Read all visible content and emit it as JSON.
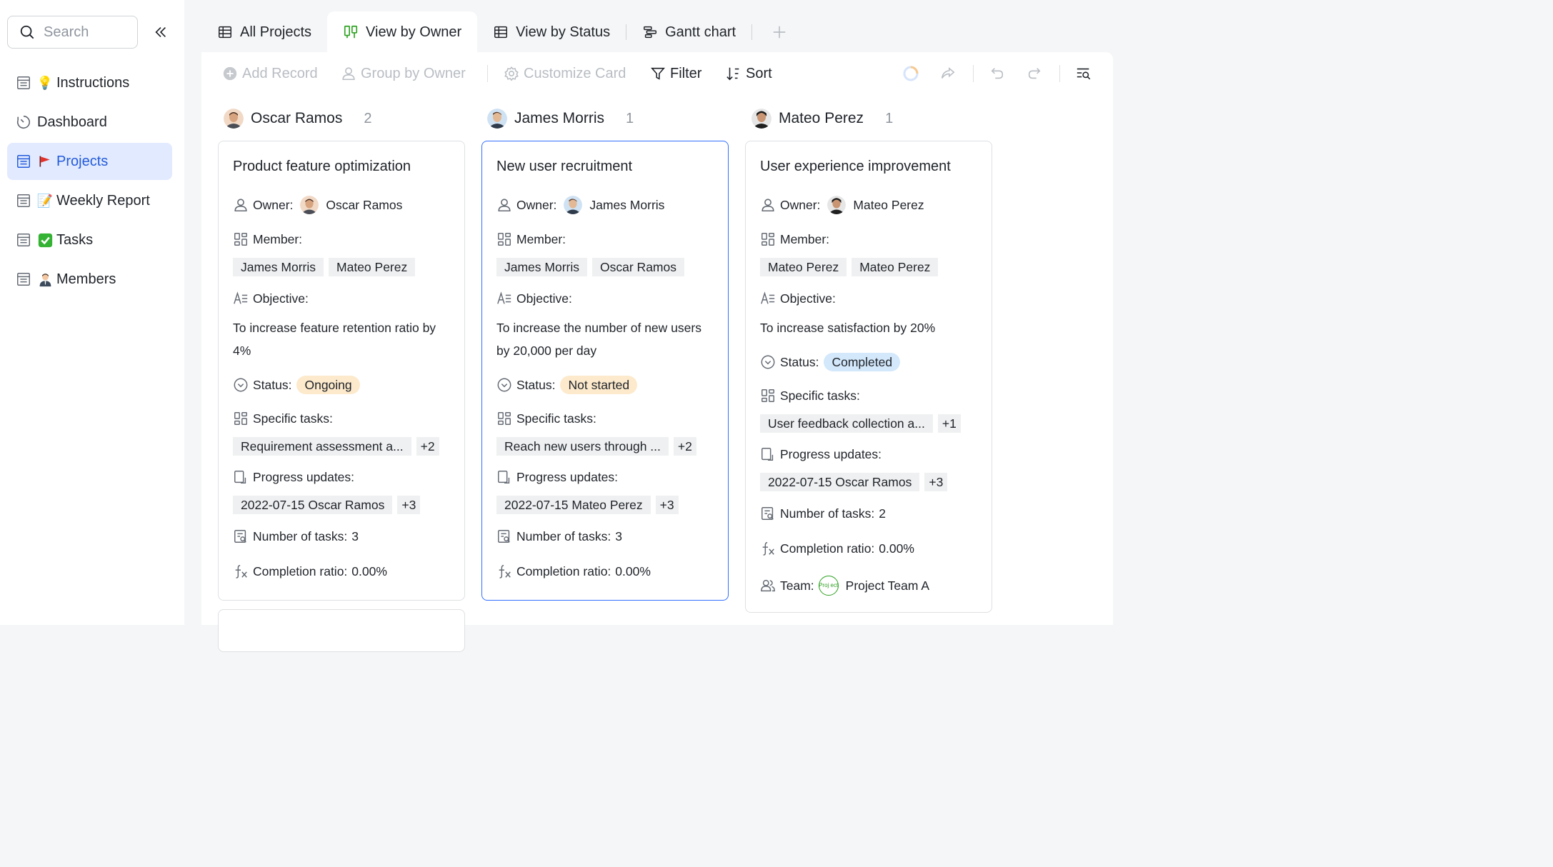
{
  "sidebar": {
    "search_placeholder": "Search",
    "items": [
      {
        "label": "Instructions",
        "emoji": "💡"
      },
      {
        "label": "Dashboard",
        "emoji": ""
      },
      {
        "label": "Projects",
        "emoji": "🚩",
        "active": true
      },
      {
        "label": "Weekly Report",
        "emoji": "📝"
      },
      {
        "label": "Tasks",
        "emoji": "✅"
      },
      {
        "label": "Members",
        "emoji": "👨‍💼"
      }
    ]
  },
  "tabs": [
    {
      "label": "All Projects",
      "icon": "table-icon"
    },
    {
      "label": "View by Owner",
      "icon": "kanban-icon",
      "active": true
    },
    {
      "label": "View by Status",
      "icon": "table-icon"
    },
    {
      "label": "Gantt chart",
      "icon": "gantt-icon"
    }
  ],
  "toolbar": {
    "add_record": "Add Record",
    "group_by": "Group by Owner",
    "customize_card": "Customize Card",
    "filter": "Filter",
    "sort": "Sort"
  },
  "labels": {
    "owner": "Owner:",
    "member": "Member:",
    "objective": "Objective:",
    "status": "Status:",
    "specific_tasks": "Specific tasks:",
    "progress_updates": "Progress updates:",
    "number_of_tasks": "Number of tasks:",
    "completion_ratio": "Completion ratio:",
    "team": "Team:"
  },
  "columns": [
    {
      "owner": "Oscar Ramos",
      "count": "2",
      "card": {
        "title": "Product feature optimization",
        "owner": "Oscar Ramos",
        "members": [
          "James Morris",
          "Mateo Perez"
        ],
        "objective": "To increase feature retention ratio by 4%",
        "status": "Ongoing",
        "tasks": "Requirement assessment a...",
        "tasks_more": "+2",
        "progress": "2022-07-15 Oscar Ramos",
        "progress_more": "+3",
        "num_tasks": "3",
        "completion": "0.00%"
      }
    },
    {
      "owner": "James Morris",
      "count": "1",
      "card": {
        "title": "New user recruitment",
        "owner": "James Morris",
        "members": [
          "James Morris",
          "Oscar Ramos"
        ],
        "objective": "To increase the number of new users by 20,000 per day",
        "status": "Not started",
        "tasks": "Reach new users through ...",
        "tasks_more": "+2",
        "progress": "2022-07-15 Mateo Perez",
        "progress_more": "+3",
        "num_tasks": "3",
        "completion": "0.00%"
      }
    },
    {
      "owner": "Mateo Perez",
      "count": "1",
      "card": {
        "title": "User experience improvement",
        "owner": "Mateo Perez",
        "members": [
          "Mateo Perez",
          "Mateo Perez"
        ],
        "objective": "To increase satisfaction by 20%",
        "status": "Completed",
        "tasks": "User feedback collection a...",
        "tasks_more": "+1",
        "progress": "2022-07-15 Oscar Ramos",
        "progress_more": "+3",
        "num_tasks": "2",
        "completion": "0.00%",
        "team_badge": "Proj ect",
        "team": "Project Team A"
      }
    }
  ],
  "colors": {
    "accent": "#3370ff",
    "active_nav_bg": "#e1eaff",
    "pill_orange": "#fdeacc",
    "pill_blue": "#d3e8fb",
    "team_green": "#2ea121"
  }
}
